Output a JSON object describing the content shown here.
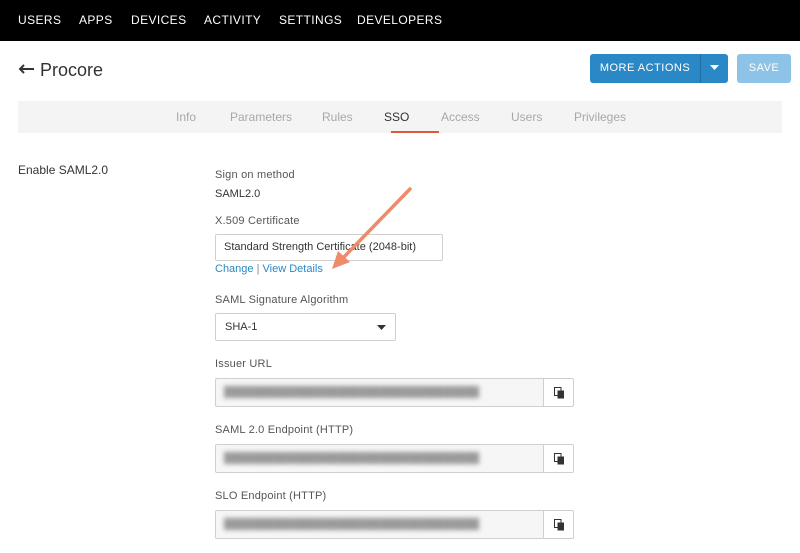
{
  "nav": {
    "items": [
      "USERS",
      "APPS",
      "DEVICES",
      "ACTIVITY",
      "SETTINGS",
      "DEVELOPERS"
    ]
  },
  "header": {
    "title": "Procore",
    "more_actions_label": "MORE ACTIONS",
    "save_label": "SAVE"
  },
  "tabs": [
    {
      "label": "Info"
    },
    {
      "label": "Parameters"
    },
    {
      "label": "Rules"
    },
    {
      "label": "SSO",
      "active": true
    },
    {
      "label": "Access"
    },
    {
      "label": "Users"
    },
    {
      "label": "Privileges"
    }
  ],
  "sso": {
    "section_label": "Enable SAML2.0",
    "sign_on_label": "Sign on method",
    "sign_on_value": "SAML2.0",
    "cert_label": "X.509 Certificate",
    "cert_value": "Standard Strength Certificate (2048-bit)",
    "change_link": "Change",
    "separator": "|",
    "view_details_link": "View Details",
    "sig_alg_label": "SAML Signature Algorithm",
    "sig_alg_value": "SHA-1",
    "issuer_label": "Issuer URL",
    "saml_endpoint_label": "SAML 2.0 Endpoint (HTTP)",
    "slo_label": "SLO Endpoint (HTTP)"
  },
  "colors": {
    "accent": "#2b88c6",
    "active_tab_underline": "#e0563f",
    "annotation_arrow": "#ef8a6b"
  },
  "icons": {
    "back": "arrow-left-icon",
    "caret": "caret-down-icon",
    "copy": "copy-icon"
  }
}
